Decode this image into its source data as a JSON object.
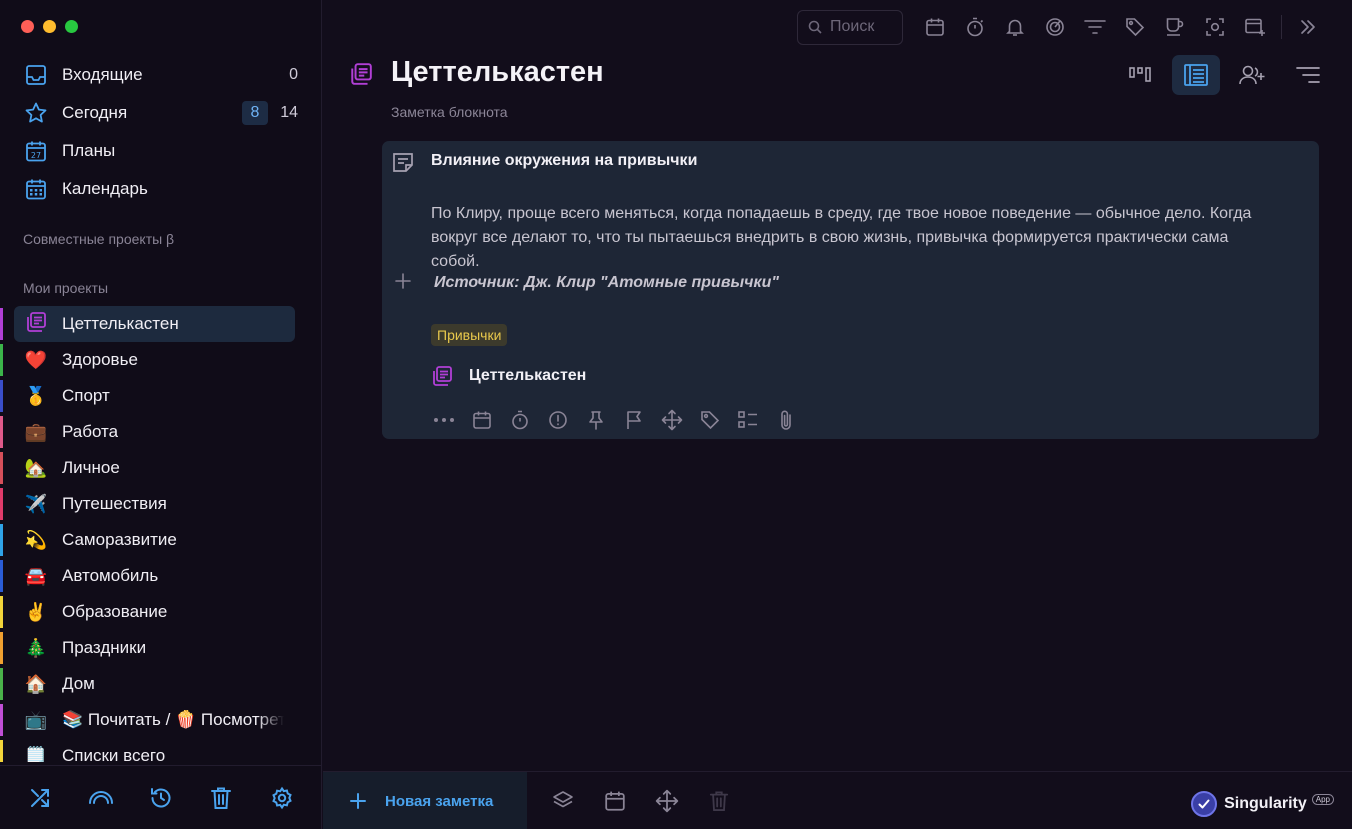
{
  "sidebar": {
    "nav": [
      {
        "label": "Входящие",
        "icon": "inbox-icon",
        "count": "0",
        "badge": ""
      },
      {
        "label": "Сегодня",
        "icon": "star-icon",
        "count": "14",
        "badge": "8"
      },
      {
        "label": "Планы",
        "icon": "calendar-27-icon",
        "count": "",
        "badge": ""
      },
      {
        "label": "Календарь",
        "icon": "calendar-grid-icon",
        "count": "",
        "badge": ""
      }
    ],
    "shared_projects_title": "Совместные проекты β",
    "my_projects_title": "Мои проекты",
    "projects": [
      {
        "label": "Цеттелькастен",
        "emoji": "",
        "color": "#b13fd6",
        "active": true
      },
      {
        "label": "Здоровье",
        "emoji": "❤️",
        "color": "#3bb54a"
      },
      {
        "label": "Спорт",
        "emoji": "🥇",
        "color": "#3a4ec9"
      },
      {
        "label": "Работа",
        "emoji": "💼",
        "color": "#e05a8a"
      },
      {
        "label": "Личное",
        "emoji": "🏡",
        "color": "#d64f5a"
      },
      {
        "label": "Путешествия",
        "emoji": "✈️",
        "color": "#e03b6a"
      },
      {
        "label": "Саморазвитие",
        "emoji": "💫",
        "color": "#2fa3e8"
      },
      {
        "label": "Автомобиль",
        "emoji": "🚘",
        "color": "#2a5cd6"
      },
      {
        "label": "Образование",
        "emoji": "✌️",
        "color": "#f2d43a"
      },
      {
        "label": "Праздники",
        "emoji": "🎄",
        "color": "#f0a030"
      },
      {
        "label": "Дом",
        "emoji": "🏠",
        "color": "#4ab24a"
      },
      {
        "label": "📚 Почитать / 🍿 Посмотреть",
        "emoji": "📺",
        "color": "#c04fd6"
      },
      {
        "label": "Списки всего",
        "emoji": "🗒️",
        "color": "#f2d43a"
      }
    ]
  },
  "toolbar": {
    "search_placeholder": "Поиск"
  },
  "page": {
    "title": "Цеттелькастен",
    "subtitle": "Заметка блокнота"
  },
  "note": {
    "title": "Влияние окружения на привычки",
    "body": "По Клиру, проще всего меняться, когда попадаешь в среду, где твое новое поведение — обычное дело. Когда вокруг все делают то, что ты пытаешься внедрить в свою жизнь, привычка формируется практически сама собой.",
    "source": "Источник: Дж. Клир \"Атомные привычки\"",
    "tag": "Привычки",
    "project": "Цеттелькастен"
  },
  "bottom": {
    "new_note_label": "Новая заметка",
    "brand": "Singularity",
    "brand_suffix": "App"
  },
  "colors": {
    "accent": "#4aa3ee",
    "project_accent": "#b13fd6",
    "tag_text": "#e8c84c"
  }
}
